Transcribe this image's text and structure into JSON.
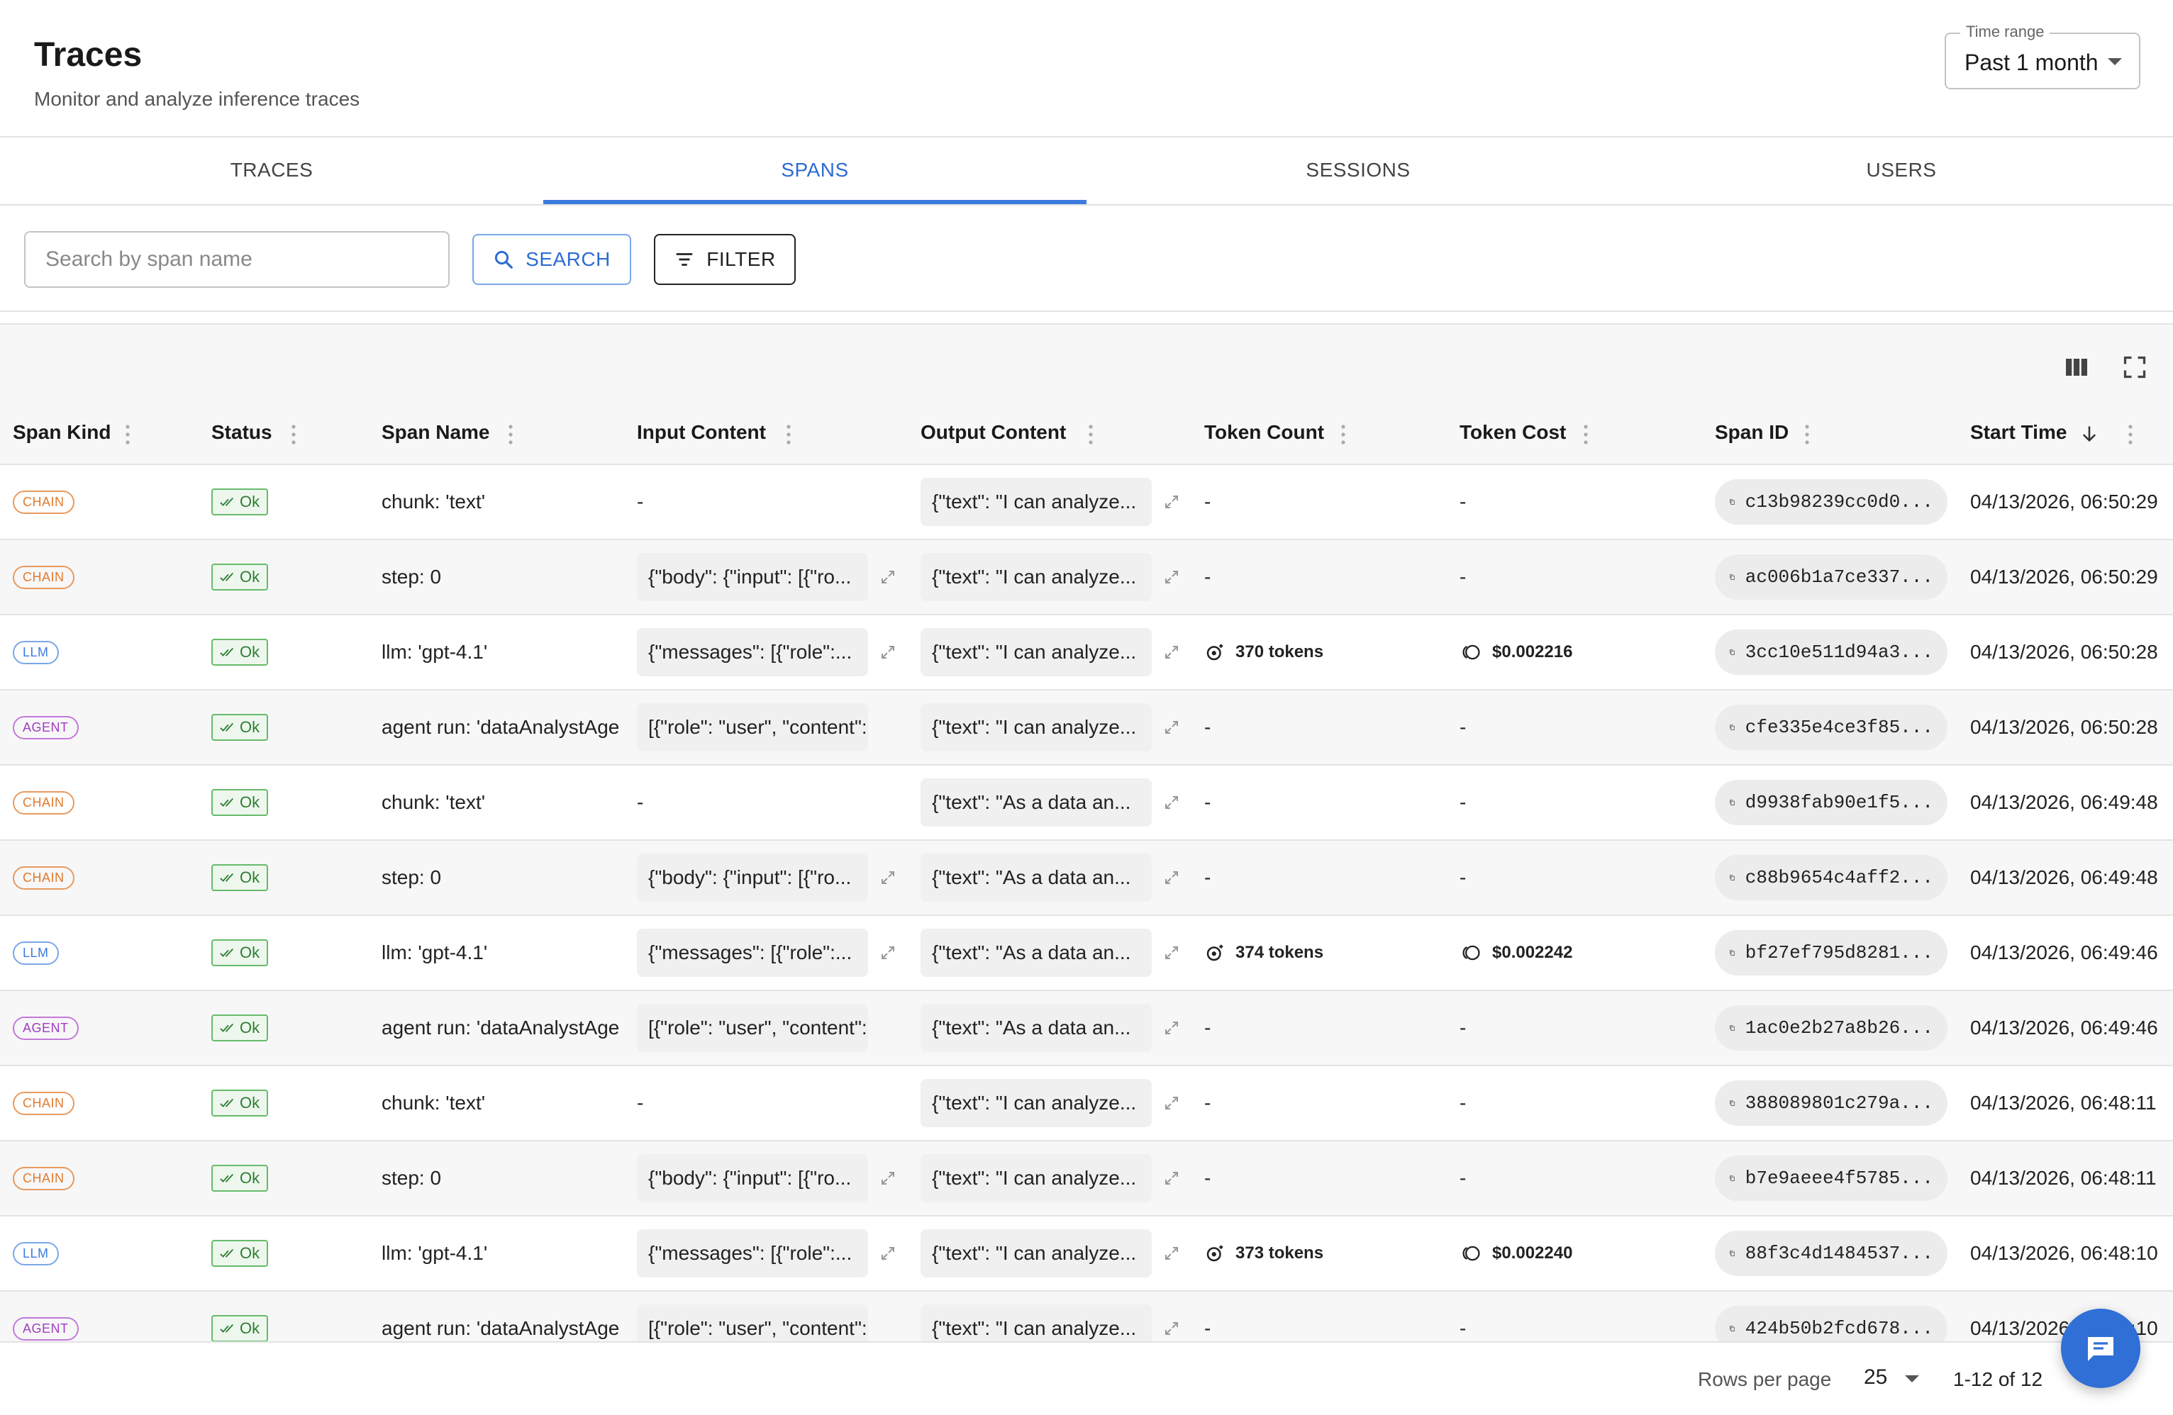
{
  "header": {
    "title": "Traces",
    "subtitle": "Monitor and analyze inference traces",
    "time_range": {
      "label": "Time range",
      "value": "Past 1 month"
    }
  },
  "tabs": [
    {
      "label": "TRACES",
      "active": false
    },
    {
      "label": "SPANS",
      "active": true
    },
    {
      "label": "SESSIONS",
      "active": false
    },
    {
      "label": "USERS",
      "active": false
    }
  ],
  "toolbar": {
    "search_placeholder": "Search by span name",
    "search_label": "SEARCH",
    "filter_label": "FILTER"
  },
  "columns": [
    "Span Kind",
    "Status",
    "Span Name",
    "Input Content",
    "Output Content",
    "Token Count",
    "Token Cost",
    "Span ID",
    "Start Time"
  ],
  "rows": [
    {
      "kind": "CHAIN",
      "status": "Ok",
      "name": "chunk: 'text'",
      "input": "-",
      "output": "{\"text\": \"I can analyze...",
      "tokens": "-",
      "cost": "-",
      "span_id": "c13b98239cc0d0...",
      "start": "04/13/2026, 06:50:29"
    },
    {
      "kind": "CHAIN",
      "status": "Ok",
      "name": "step: 0",
      "input": "{\"body\": {\"input\": [{\"ro...",
      "output": "{\"text\": \"I can analyze...",
      "tokens": "-",
      "cost": "-",
      "span_id": "ac006b1a7ce337...",
      "start": "04/13/2026, 06:50:29"
    },
    {
      "kind": "LLM",
      "status": "Ok",
      "name": "llm: 'gpt-4.1'",
      "input": "{\"messages\": [{\"role\":...",
      "output": "{\"text\": \"I can analyze...",
      "tokens": "370 tokens",
      "cost": "$0.002216",
      "span_id": "3cc10e511d94a3...",
      "start": "04/13/2026, 06:50:28"
    },
    {
      "kind": "AGENT",
      "status": "Ok",
      "name": "agent run: 'dataAnalystAge",
      "input": "[{\"role\": \"user\", \"content\": \"wh",
      "output": "{\"text\": \"I can analyze...",
      "tokens": "-",
      "cost": "-",
      "span_id": "cfe335e4ce3f85...",
      "start": "04/13/2026, 06:50:28"
    },
    {
      "kind": "CHAIN",
      "status": "Ok",
      "name": "chunk: 'text'",
      "input": "-",
      "output": "{\"text\": \"As a data an...",
      "tokens": "-",
      "cost": "-",
      "span_id": "d9938fab90e1f5...",
      "start": "04/13/2026, 06:49:48"
    },
    {
      "kind": "CHAIN",
      "status": "Ok",
      "name": "step: 0",
      "input": "{\"body\": {\"input\": [{\"ro...",
      "output": "{\"text\": \"As a data an...",
      "tokens": "-",
      "cost": "-",
      "span_id": "c88b9654c4aff2...",
      "start": "04/13/2026, 06:49:48"
    },
    {
      "kind": "LLM",
      "status": "Ok",
      "name": "llm: 'gpt-4.1'",
      "input": "{\"messages\": [{\"role\":...",
      "output": "{\"text\": \"As a data an...",
      "tokens": "374 tokens",
      "cost": "$0.002242",
      "span_id": "bf27ef795d8281...",
      "start": "04/13/2026, 06:49:46"
    },
    {
      "kind": "AGENT",
      "status": "Ok",
      "name": "agent run: 'dataAnalystAge",
      "input": "[{\"role\": \"user\", \"content\": \"is t",
      "output": "{\"text\": \"As a data an...",
      "tokens": "-",
      "cost": "-",
      "span_id": "1ac0e2b27a8b26...",
      "start": "04/13/2026, 06:49:46"
    },
    {
      "kind": "CHAIN",
      "status": "Ok",
      "name": "chunk: 'text'",
      "input": "-",
      "output": "{\"text\": \"I can analyze...",
      "tokens": "-",
      "cost": "-",
      "span_id": "388089801c279a...",
      "start": "04/13/2026, 06:48:11"
    },
    {
      "kind": "CHAIN",
      "status": "Ok",
      "name": "step: 0",
      "input": "{\"body\": {\"input\": [{\"ro...",
      "output": "{\"text\": \"I can analyze...",
      "tokens": "-",
      "cost": "-",
      "span_id": "b7e9aeee4f5785...",
      "start": "04/13/2026, 06:48:11"
    },
    {
      "kind": "LLM",
      "status": "Ok",
      "name": "llm: 'gpt-4.1'",
      "input": "{\"messages\": [{\"role\":...",
      "output": "{\"text\": \"I can analyze...",
      "tokens": "373 tokens",
      "cost": "$0.002240",
      "span_id": "88f3c4d1484537...",
      "start": "04/13/2026, 06:48:10"
    },
    {
      "kind": "AGENT",
      "status": "Ok",
      "name": "agent run: 'dataAnalystAge",
      "input": "[{\"role\": \"user\", \"content\": \"wh",
      "output": "{\"text\": \"I can analyze...",
      "tokens": "-",
      "cost": "-",
      "span_id": "424b50b2fcd678...",
      "start": "04/13/2026, 06:48:10"
    }
  ],
  "pagination": {
    "rows_per_page_label": "Rows per page",
    "rows_per_page": "25",
    "range": "1-12 of 12"
  },
  "colors": {
    "accent": "#2d6cd3",
    "chain": "#e07a2f",
    "llm": "#3b7be0",
    "agent": "#a23cc1",
    "ok": "#2e7d32"
  },
  "icons": [
    "search-icon",
    "filter-icon",
    "columns-icon",
    "fullscreen-icon",
    "kebab-icon",
    "sort-desc-icon",
    "check-icon",
    "expand-icon",
    "copy-icon",
    "token-icon",
    "coin-icon",
    "chat-icon",
    "chevron-down-icon"
  ]
}
